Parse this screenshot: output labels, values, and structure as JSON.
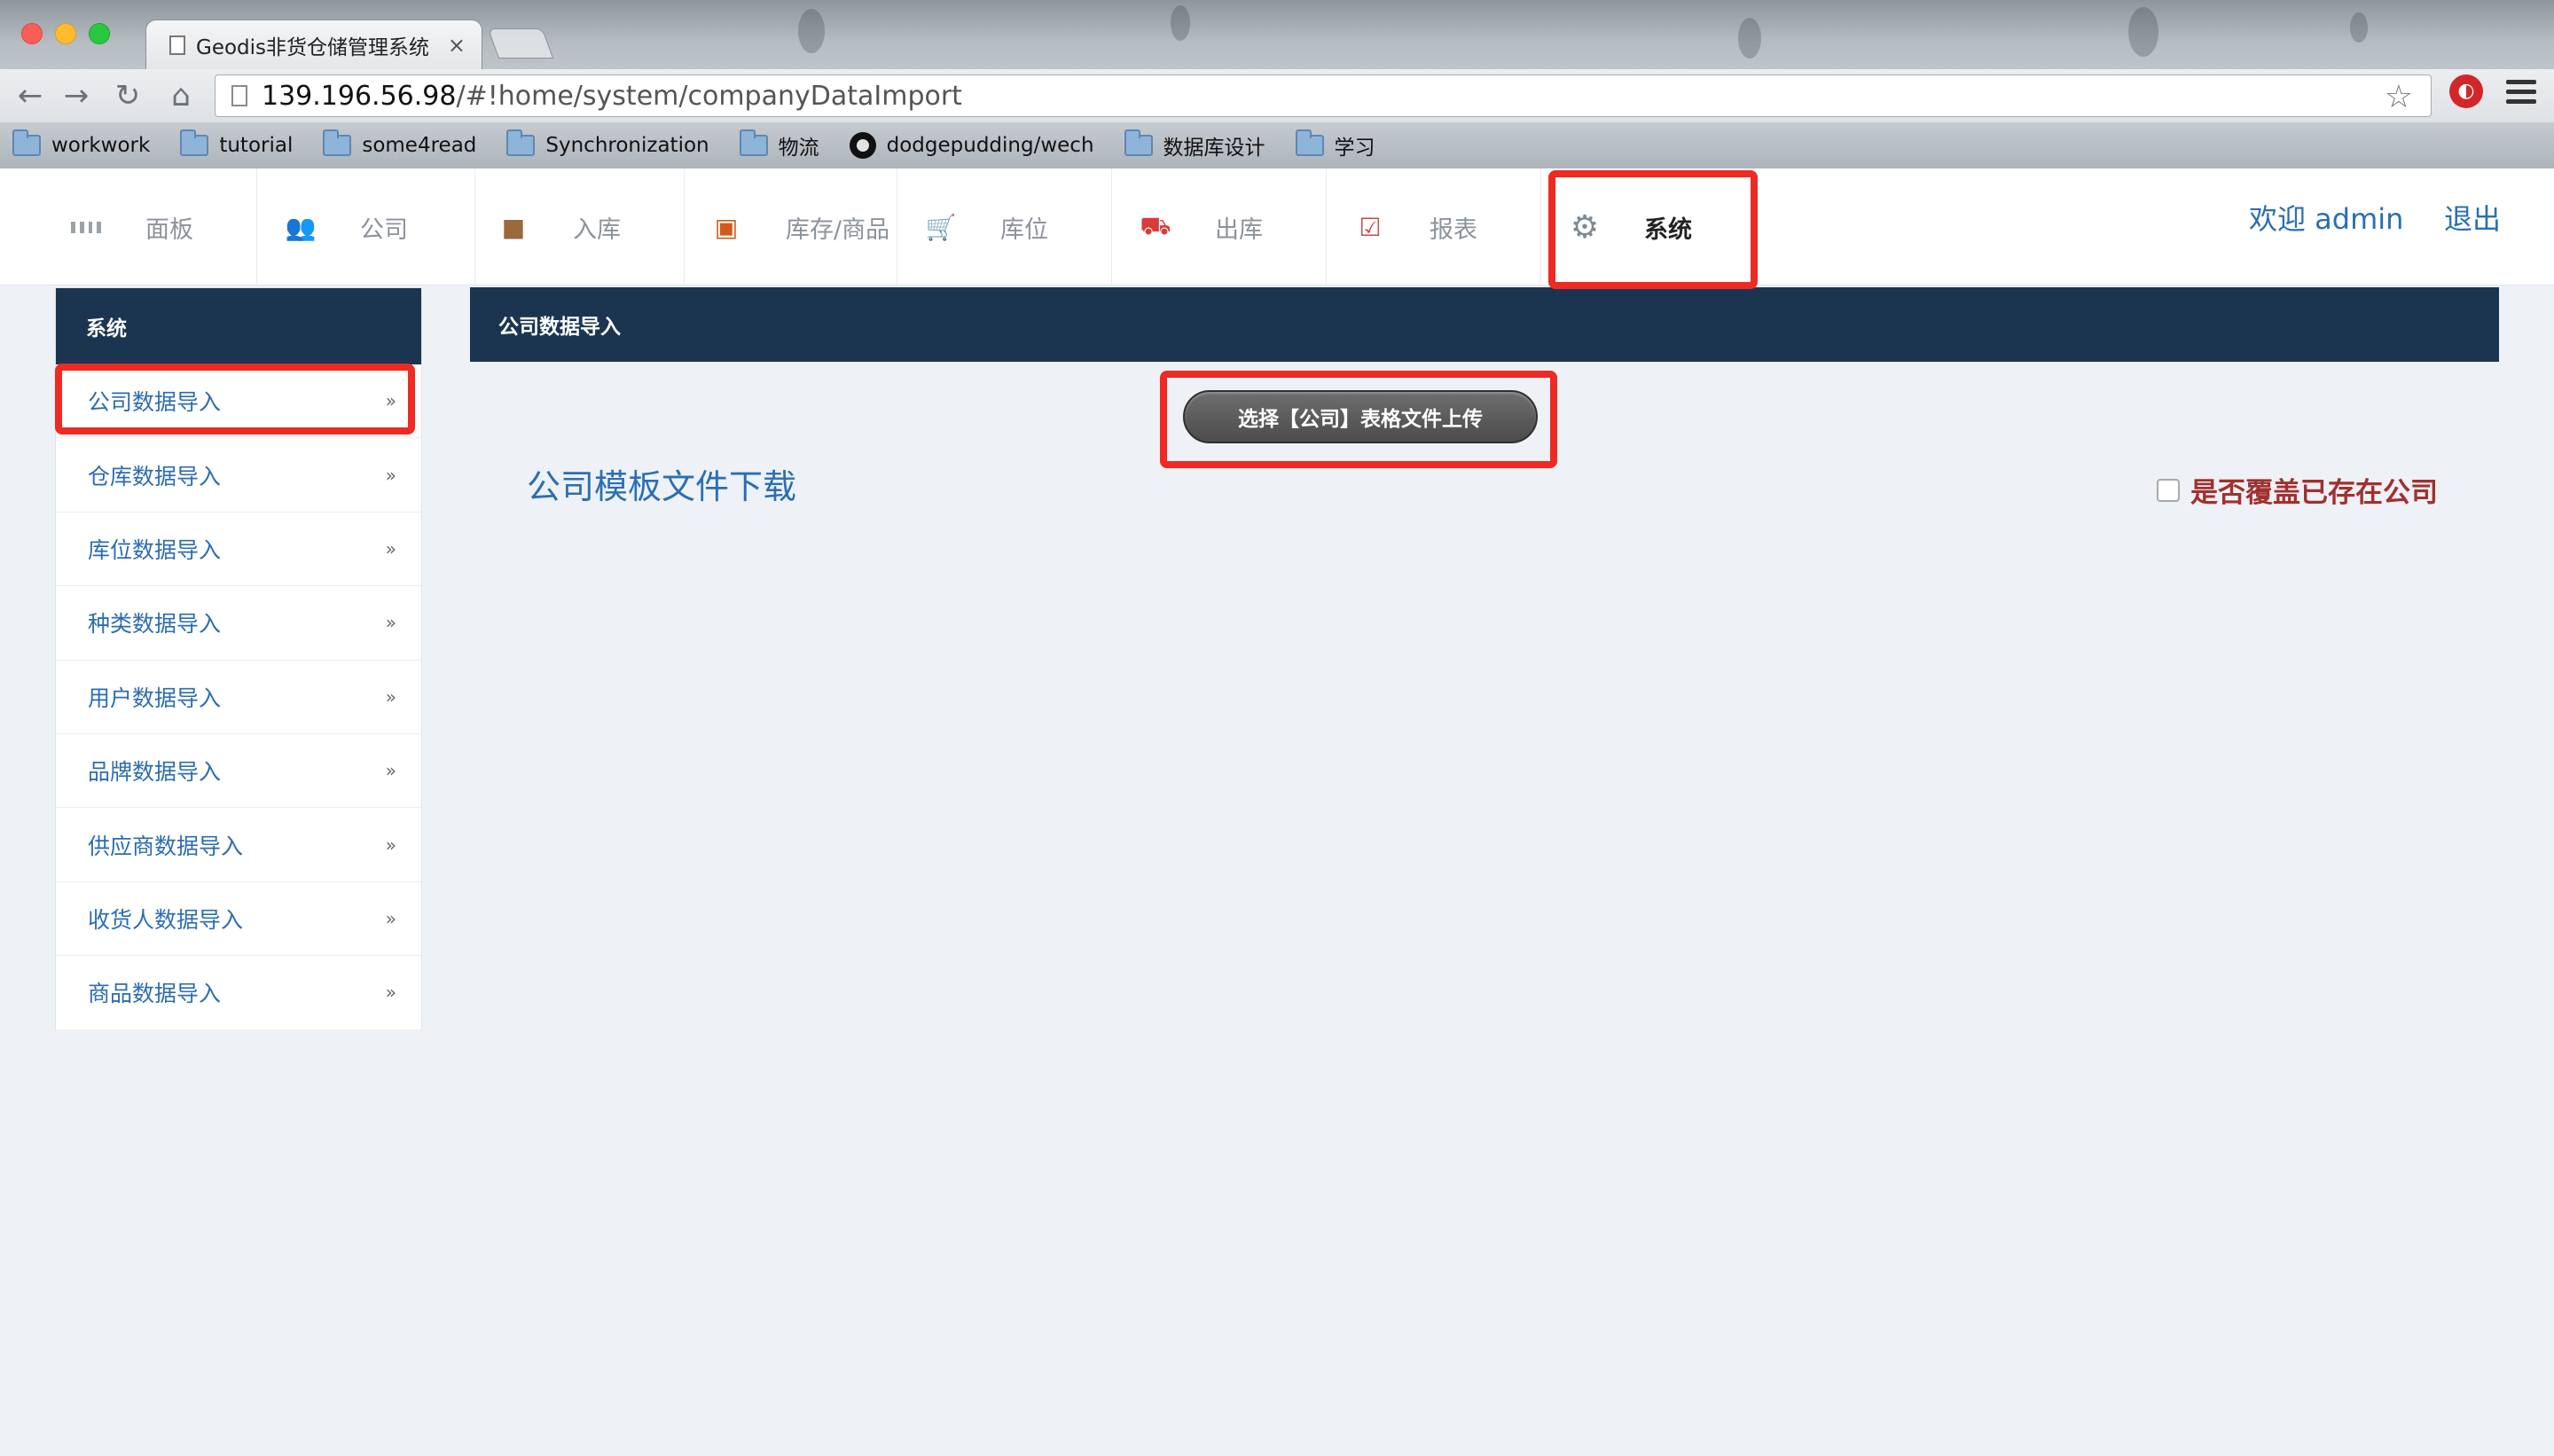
{
  "browser": {
    "tab_title": "Geodis非货仓储管理系统",
    "tab_close": "×",
    "url_host": "139.196.56.98",
    "url_path": "/#!home/system/companyDataImport",
    "bookmarks": [
      "workwork",
      "tutorial",
      "some4read",
      "Synchronization",
      "物流",
      "dodgepudding/wech",
      "数据库设计",
      "学习"
    ]
  },
  "topnav": {
    "items": [
      "面板",
      "公司",
      "入库",
      "库存/商品",
      "库位",
      "出库",
      "报表",
      "系统"
    ],
    "active": "系统",
    "welcome": "欢迎 admin",
    "logout": "退出"
  },
  "sidebar": {
    "title": "系统",
    "items": [
      "公司数据导入",
      "仓库数据导入",
      "库位数据导入",
      "种类数据导入",
      "用户数据导入",
      "品牌数据导入",
      "供应商数据导入",
      "收货人数据导入",
      "商品数据导入"
    ],
    "chevron": "»"
  },
  "main": {
    "title": "公司数据导入",
    "upload_button": "选择【公司】表格文件上传",
    "template_link": "公司模板文件下载",
    "overwrite_label": "是否覆盖已存在公司",
    "overwrite_checked": false
  },
  "colors": {
    "header_navy": "#1b3551",
    "link_blue": "#2a6fb2",
    "annotation_red": "#ee2a22",
    "overwrite_red": "#a1302f"
  }
}
